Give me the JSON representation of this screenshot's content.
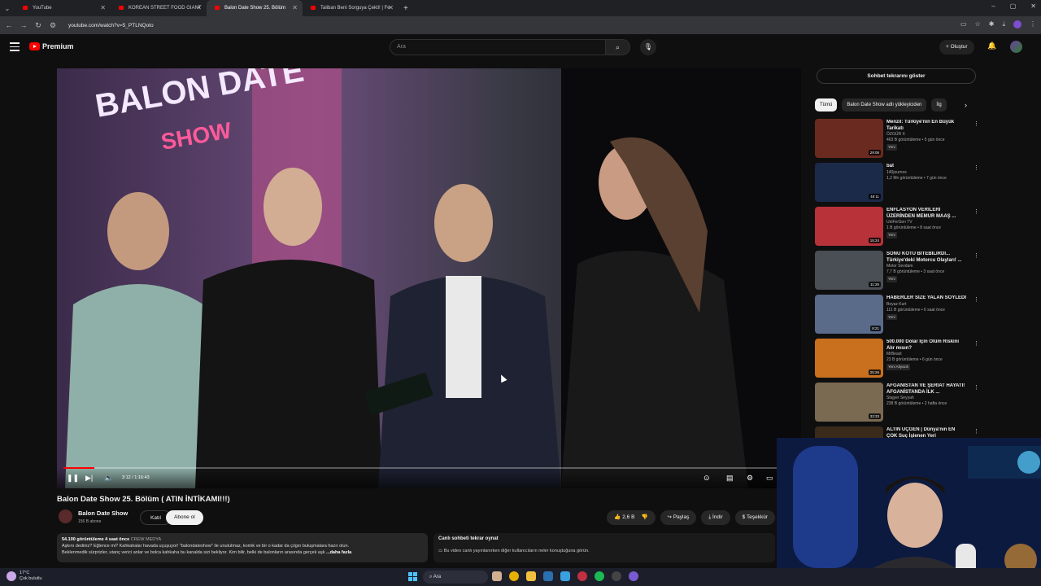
{
  "browser": {
    "tabs": [
      {
        "title": "YouTube",
        "active": false
      },
      {
        "title": "KOREAN STREET FOOD GIANT",
        "active": false
      },
      {
        "title": "Balon Date Show 25. Bölüm",
        "active": true
      },
      {
        "title": "Taliban Beni Sorguya Çekti! | Fe",
        "active": false
      }
    ],
    "url": "youtube.com/watch?v=5_PTLNQoto"
  },
  "header": {
    "logo": "Premium",
    "search_placeholder": "Ara",
    "create_label": "Oluştur"
  },
  "player": {
    "time": "3:12 / 1:16:43",
    "progress": 0.042
  },
  "video": {
    "title": "Balon Date Show 25. Bölüm ( ATIN İNTİKAMI!!!)",
    "channel": "Balon Date Show",
    "subscribers": "156 B abone",
    "join_label": "Katıl",
    "subscribe_label": "Abone ol",
    "likes": "2,6 B",
    "share_label": "Paylaş",
    "download_label": "İndir",
    "thanks_label": "Teşekkür"
  },
  "description": {
    "stats": "54.100 görüntüleme  4 saat önce",
    "hashtag": "CREW MEDYA",
    "line1": "Aşkını dediniz? Eğlence mi? Kahkahalar havada uçuşuyor! \"balondateshow\" ile unutulmaz, komik ve bir o kadar da çılgın buluşmalara hazır olun.",
    "line2": "Beklenmedik sürprizler, utanç verici anlar ve bolca kahkaha bu kanalda sizi bekliyor. Kim bilir, belki de balonların arasında gerçek aşk",
    "more": "...daha fazla"
  },
  "livechat": {
    "title": "Canlı sohbeti tekrar oynat",
    "subtitle": "Bu video canlı yayınlanırken diğer kullanıcıların neler konuştuğuna görün."
  },
  "sidebar": {
    "chat_button": "Sohbet tekrarını göster",
    "chips": [
      "Tümü",
      "Balon Date Show adlı yükleyiciden",
      "İlg"
    ],
    "recommendations": [
      {
        "title": "Menzil: Türkiye'nin En Büyük Tarikatı",
        "channel": "ÖZGÜR X",
        "meta": "463 B görüntüleme • 5 gün önce",
        "badge": "Yeni",
        "duration": "29:08",
        "color": "#6b2a1f"
      },
      {
        "title": "bat",
        "channel": "140journos",
        "meta": "1,2 Mn görüntüleme • 7 gün önce",
        "badge": "",
        "duration": "48:11",
        "color": "#1c2a4a"
      },
      {
        "title": "ENFLASYON VERİLERİ ÜZERİNDEN MEMUR MAAŞ ...",
        "channel": "UniFerSen TV",
        "meta": "1 B görüntüleme • 8 saat önce",
        "badge": "Yeni",
        "duration": "15:24",
        "color": "#b8323a"
      },
      {
        "title": "SONU KÖTÜ BİTEBİLİRDİ... Türkiye'deki Motorcu Olayları! ...",
        "channel": "Motor Sevdam",
        "meta": "7,7 B görüntüleme • 3 saat önce",
        "badge": "Yeni",
        "duration": "11:25",
        "color": "#4a4f55"
      },
      {
        "title": "HABERLER SİZE YALAN SÖYLEDİ",
        "channel": "Beyaz Kurt",
        "meta": "111 B görüntüleme • 6 saat önce",
        "badge": "Yeni",
        "duration": "8:21",
        "color": "#5a6b8a"
      },
      {
        "title": "500.000 Dolar İçin Ölüm Riskini Alır mısın?",
        "channel": "MrBeast",
        "meta": "23 B görüntüleme • 6 gün önce",
        "badge": "Yeni  Altyazılı",
        "duration": "25:26",
        "color": "#c8701e"
      },
      {
        "title": "AFGANİSTAN VE ŞERİAT HAYATI! AFGANİSTANDA İLK ...",
        "channel": "Stajyer Seyyah",
        "meta": "238 B görüntüleme • 2 hafta önce",
        "badge": "",
        "duration": "33:33",
        "color": "#7a6a52"
      },
      {
        "title": "ALTIN ÜÇGEN | Dünya'nın EN ÇOK Suç İşlenen Yeri",
        "channel": "",
        "meta": "",
        "badge": "",
        "duration": "",
        "color": "#3a2a1a"
      }
    ]
  },
  "taskbar": {
    "temp": "17°C",
    "weather": "Çok bulutlu",
    "search": "Ara"
  }
}
